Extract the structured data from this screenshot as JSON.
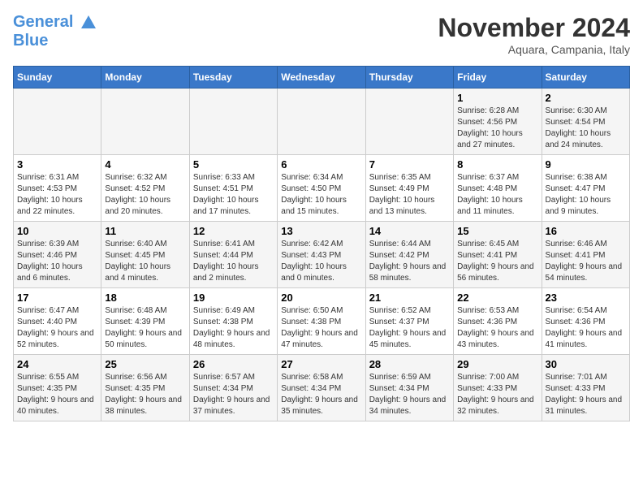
{
  "header": {
    "logo_line1": "General",
    "logo_line2": "Blue",
    "month_title": "November 2024",
    "subtitle": "Aquara, Campania, Italy"
  },
  "weekdays": [
    "Sunday",
    "Monday",
    "Tuesday",
    "Wednesday",
    "Thursday",
    "Friday",
    "Saturday"
  ],
  "weeks": [
    [
      {
        "day": "",
        "info": ""
      },
      {
        "day": "",
        "info": ""
      },
      {
        "day": "",
        "info": ""
      },
      {
        "day": "",
        "info": ""
      },
      {
        "day": "",
        "info": ""
      },
      {
        "day": "1",
        "info": "Sunrise: 6:28 AM\nSunset: 4:56 PM\nDaylight: 10 hours and 27 minutes."
      },
      {
        "day": "2",
        "info": "Sunrise: 6:30 AM\nSunset: 4:54 PM\nDaylight: 10 hours and 24 minutes."
      }
    ],
    [
      {
        "day": "3",
        "info": "Sunrise: 6:31 AM\nSunset: 4:53 PM\nDaylight: 10 hours and 22 minutes."
      },
      {
        "day": "4",
        "info": "Sunrise: 6:32 AM\nSunset: 4:52 PM\nDaylight: 10 hours and 20 minutes."
      },
      {
        "day": "5",
        "info": "Sunrise: 6:33 AM\nSunset: 4:51 PM\nDaylight: 10 hours and 17 minutes."
      },
      {
        "day": "6",
        "info": "Sunrise: 6:34 AM\nSunset: 4:50 PM\nDaylight: 10 hours and 15 minutes."
      },
      {
        "day": "7",
        "info": "Sunrise: 6:35 AM\nSunset: 4:49 PM\nDaylight: 10 hours and 13 minutes."
      },
      {
        "day": "8",
        "info": "Sunrise: 6:37 AM\nSunset: 4:48 PM\nDaylight: 10 hours and 11 minutes."
      },
      {
        "day": "9",
        "info": "Sunrise: 6:38 AM\nSunset: 4:47 PM\nDaylight: 10 hours and 9 minutes."
      }
    ],
    [
      {
        "day": "10",
        "info": "Sunrise: 6:39 AM\nSunset: 4:46 PM\nDaylight: 10 hours and 6 minutes."
      },
      {
        "day": "11",
        "info": "Sunrise: 6:40 AM\nSunset: 4:45 PM\nDaylight: 10 hours and 4 minutes."
      },
      {
        "day": "12",
        "info": "Sunrise: 6:41 AM\nSunset: 4:44 PM\nDaylight: 10 hours and 2 minutes."
      },
      {
        "day": "13",
        "info": "Sunrise: 6:42 AM\nSunset: 4:43 PM\nDaylight: 10 hours and 0 minutes."
      },
      {
        "day": "14",
        "info": "Sunrise: 6:44 AM\nSunset: 4:42 PM\nDaylight: 9 hours and 58 minutes."
      },
      {
        "day": "15",
        "info": "Sunrise: 6:45 AM\nSunset: 4:41 PM\nDaylight: 9 hours and 56 minutes."
      },
      {
        "day": "16",
        "info": "Sunrise: 6:46 AM\nSunset: 4:41 PM\nDaylight: 9 hours and 54 minutes."
      }
    ],
    [
      {
        "day": "17",
        "info": "Sunrise: 6:47 AM\nSunset: 4:40 PM\nDaylight: 9 hours and 52 minutes."
      },
      {
        "day": "18",
        "info": "Sunrise: 6:48 AM\nSunset: 4:39 PM\nDaylight: 9 hours and 50 minutes."
      },
      {
        "day": "19",
        "info": "Sunrise: 6:49 AM\nSunset: 4:38 PM\nDaylight: 9 hours and 48 minutes."
      },
      {
        "day": "20",
        "info": "Sunrise: 6:50 AM\nSunset: 4:38 PM\nDaylight: 9 hours and 47 minutes."
      },
      {
        "day": "21",
        "info": "Sunrise: 6:52 AM\nSunset: 4:37 PM\nDaylight: 9 hours and 45 minutes."
      },
      {
        "day": "22",
        "info": "Sunrise: 6:53 AM\nSunset: 4:36 PM\nDaylight: 9 hours and 43 minutes."
      },
      {
        "day": "23",
        "info": "Sunrise: 6:54 AM\nSunset: 4:36 PM\nDaylight: 9 hours and 41 minutes."
      }
    ],
    [
      {
        "day": "24",
        "info": "Sunrise: 6:55 AM\nSunset: 4:35 PM\nDaylight: 9 hours and 40 minutes."
      },
      {
        "day": "25",
        "info": "Sunrise: 6:56 AM\nSunset: 4:35 PM\nDaylight: 9 hours and 38 minutes."
      },
      {
        "day": "26",
        "info": "Sunrise: 6:57 AM\nSunset: 4:34 PM\nDaylight: 9 hours and 37 minutes."
      },
      {
        "day": "27",
        "info": "Sunrise: 6:58 AM\nSunset: 4:34 PM\nDaylight: 9 hours and 35 minutes."
      },
      {
        "day": "28",
        "info": "Sunrise: 6:59 AM\nSunset: 4:34 PM\nDaylight: 9 hours and 34 minutes."
      },
      {
        "day": "29",
        "info": "Sunrise: 7:00 AM\nSunset: 4:33 PM\nDaylight: 9 hours and 32 minutes."
      },
      {
        "day": "30",
        "info": "Sunrise: 7:01 AM\nSunset: 4:33 PM\nDaylight: 9 hours and 31 minutes."
      }
    ]
  ]
}
